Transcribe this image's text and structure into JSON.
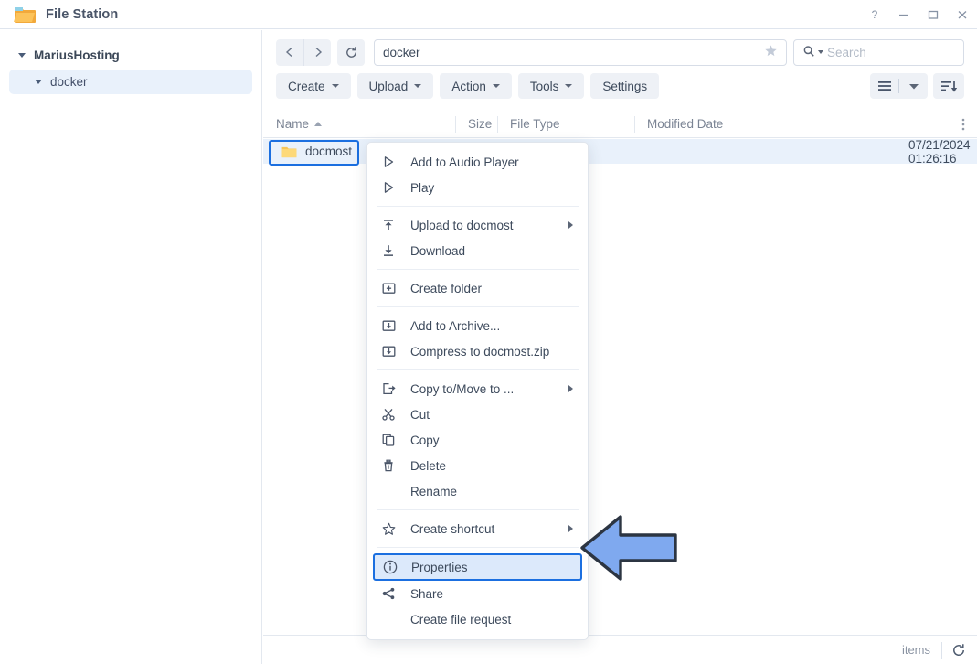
{
  "window": {
    "title": "File Station",
    "icon": "folder-icon",
    "controls": [
      {
        "name": "help-button",
        "glyph": "?"
      },
      {
        "name": "minimize-button",
        "glyph": "—"
      },
      {
        "name": "maximize-button",
        "glyph": "▢"
      },
      {
        "name": "close-button",
        "glyph": "✕"
      }
    ]
  },
  "sidebar": {
    "items": [
      {
        "label": "MariusHosting",
        "level": 0,
        "expanded": true,
        "selected": false
      },
      {
        "label": "docker",
        "level": 1,
        "expanded": true,
        "selected": true
      }
    ]
  },
  "navbar": {
    "back_icon": "chevron-left-icon",
    "forward_icon": "chevron-right-icon",
    "refresh_icon": "refresh-icon",
    "path_value": "docker",
    "favorite_icon": "star-icon",
    "search_icon": "search-icon",
    "search_placeholder": "Search",
    "search_value": ""
  },
  "toolbar": {
    "buttons": [
      {
        "label": "Create",
        "has_caret": true
      },
      {
        "label": "Upload",
        "has_caret": true
      },
      {
        "label": "Action",
        "has_caret": true
      },
      {
        "label": "Tools",
        "has_caret": true
      },
      {
        "label": "Settings",
        "has_caret": false
      }
    ],
    "view_icon": "list-view-icon",
    "view_caret_icon": "chevron-down-icon",
    "sort_icon": "sort-descending-icon"
  },
  "list": {
    "columns": [
      {
        "label": "Name",
        "sorted": true,
        "sort_dir": "asc"
      },
      {
        "label": "Size",
        "sorted": false
      },
      {
        "label": "File Type",
        "sorted": false
      },
      {
        "label": "Modified Date",
        "sorted": false
      }
    ],
    "column_options_icon": "kebab-menu-icon",
    "rows": [
      {
        "name": "docmost",
        "icon": "folder-icon",
        "size": "",
        "file_type": "",
        "modified_date": "07/21/2024 01:26:16",
        "selected": true
      }
    ]
  },
  "statusbar": {
    "items_text": "items",
    "refresh_icon": "refresh-icon"
  },
  "context_menu": {
    "groups": [
      {
        "items": [
          {
            "label": "Add to Audio Player",
            "icon": "play-outline-icon",
            "submenu": false
          },
          {
            "label": "Play",
            "icon": "play-outline-icon",
            "submenu": false
          }
        ]
      },
      {
        "items": [
          {
            "label": "Upload to docmost",
            "icon": "upload-icon",
            "submenu": true
          },
          {
            "label": "Download",
            "icon": "download-icon",
            "submenu": false
          }
        ]
      },
      {
        "items": [
          {
            "label": "Create folder",
            "icon": "new-folder-icon",
            "submenu": false
          }
        ]
      },
      {
        "items": [
          {
            "label": "Add to Archive...",
            "icon": "archive-icon",
            "submenu": false
          },
          {
            "label": "Compress to docmost.zip",
            "icon": "archive-icon",
            "submenu": false
          }
        ]
      },
      {
        "items": [
          {
            "label": "Copy to/Move to ...",
            "icon": "copy-move-icon",
            "submenu": true
          },
          {
            "label": "Cut",
            "icon": "scissors-icon",
            "submenu": false
          },
          {
            "label": "Copy",
            "icon": "copy-icon",
            "submenu": false
          },
          {
            "label": "Delete",
            "icon": "trash-icon",
            "submenu": false
          },
          {
            "label": "Rename",
            "icon": "",
            "submenu": false
          }
        ]
      },
      {
        "items": [
          {
            "label": "Create shortcut",
            "icon": "star-outline-icon",
            "submenu": true
          }
        ]
      },
      {
        "items": [
          {
            "label": "Properties",
            "icon": "info-icon",
            "submenu": false,
            "highlighted": true
          },
          {
            "label": "Share",
            "icon": "share-icon",
            "submenu": false
          },
          {
            "label": "Create file request",
            "icon": "",
            "submenu": false
          }
        ]
      }
    ]
  },
  "annotation": {
    "arrow": {
      "direction": "left",
      "fill": "#7fa9ef",
      "stroke": "#2c3542"
    }
  },
  "colors": {
    "accent": "#1b6fe0",
    "selection_bg": "#e9f1fb",
    "highlight_bg": "#dce9fb",
    "toolbar_btn": "#eef1f6",
    "text": "#3d4a5c",
    "muted": "#8a93a2"
  }
}
